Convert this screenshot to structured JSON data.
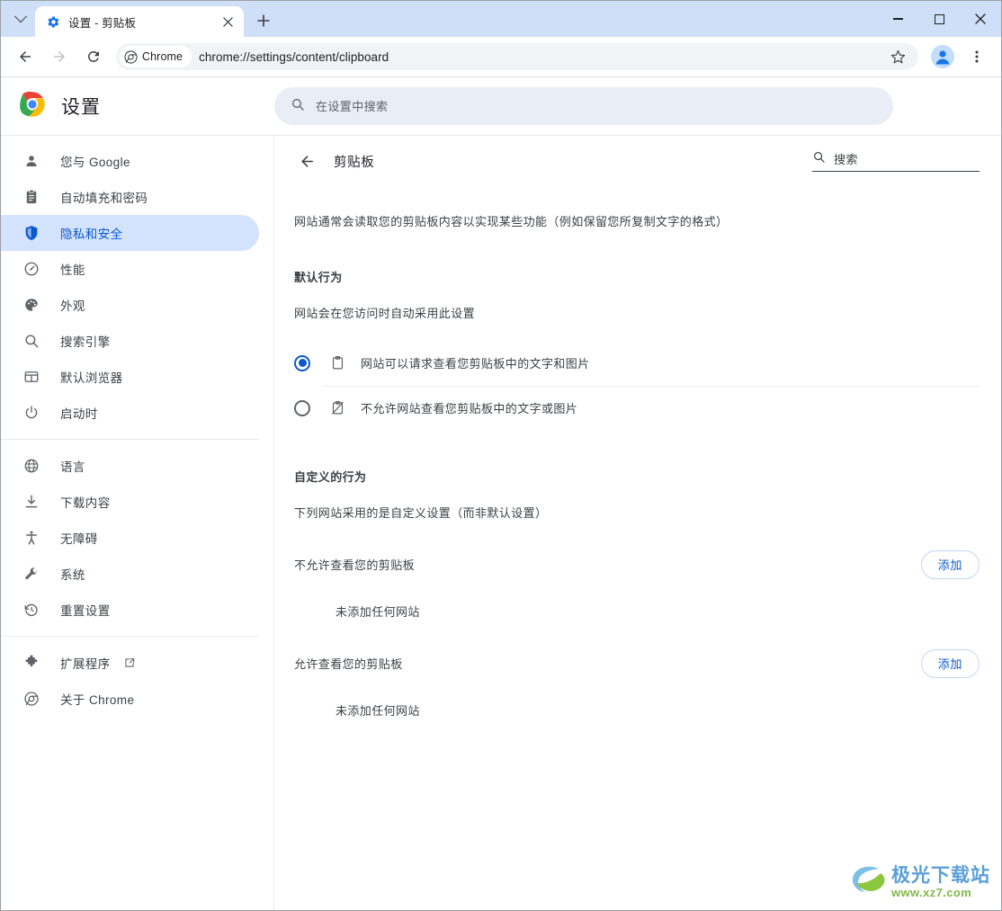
{
  "window": {
    "tab": {
      "title": "设置 - 剪贴板",
      "favicon": "gear-icon",
      "close_label": "×"
    },
    "newtab_label": "+",
    "controls": {
      "minimize": "minimize-icon",
      "maximize": "maximize-icon",
      "close": "close-icon"
    }
  },
  "toolbar": {
    "back": "back-arrow-icon",
    "forward": "forward-arrow-icon",
    "reload": "reload-icon",
    "chrome_badge": "Chrome",
    "url": "chrome://settings/content/clipboard",
    "bookmark": "star-icon",
    "profile": "profile-avatar-icon",
    "menu": "three-dot-menu-icon"
  },
  "settings_header": {
    "brand_title": "设置",
    "search_placeholder": "在设置中搜索",
    "search_value": ""
  },
  "sidebar": {
    "groups": [
      {
        "items": [
          {
            "label": "您与 Google",
            "icon": "person-icon",
            "selected": false
          },
          {
            "label": "自动填充和密码",
            "icon": "clipboard-list-icon",
            "selected": false
          },
          {
            "label": "隐私和安全",
            "icon": "shield-icon",
            "selected": true
          },
          {
            "label": "性能",
            "icon": "speedometer-icon",
            "selected": false
          },
          {
            "label": "外观",
            "icon": "palette-icon",
            "selected": false
          },
          {
            "label": "搜索引擎",
            "icon": "search-icon",
            "selected": false
          },
          {
            "label": "默认浏览器",
            "icon": "browser-window-icon",
            "selected": false
          },
          {
            "label": "启动时",
            "icon": "power-icon",
            "selected": false
          }
        ]
      },
      {
        "items": [
          {
            "label": "语言",
            "icon": "globe-icon",
            "selected": false
          },
          {
            "label": "下载内容",
            "icon": "download-icon",
            "selected": false
          },
          {
            "label": "无障碍",
            "icon": "accessibility-icon",
            "selected": false
          },
          {
            "label": "系统",
            "icon": "wrench-icon",
            "selected": false
          },
          {
            "label": "重置设置",
            "icon": "history-restore-icon",
            "selected": false
          }
        ]
      },
      {
        "items": [
          {
            "label": "扩展程序",
            "icon": "puzzle-icon",
            "selected": false,
            "external": true
          },
          {
            "label": "关于 Chrome",
            "icon": "chrome-logo-icon",
            "selected": false
          }
        ]
      }
    ]
  },
  "main": {
    "back_icon": "back-arrow-icon",
    "title": "剪贴板",
    "search_placeholder": "搜索",
    "search_value": "",
    "description": "网站通常会读取您的剪贴板内容以实现某些功能（例如保留您所复制文字的格式）",
    "default_behavior": {
      "title": "默认行为",
      "subtitle": "网站会在您访问时自动采用此设置",
      "options": [
        {
          "label": "网站可以请求查看您剪贴板中的文字和图片",
          "icon": "clipboard-icon",
          "selected": true
        },
        {
          "label": "不允许网站查看您剪贴板中的文字或图片",
          "icon": "clipboard-blocked-icon",
          "selected": false
        }
      ]
    },
    "custom_behavior": {
      "title": "自定义的行为",
      "subtitle": "下列网站采用的是自定义设置（而非默认设置）",
      "blocks": [
        {
          "title": "不允许查看您的剪贴板",
          "add_label": "添加",
          "empty_text": "未添加任何网站"
        },
        {
          "title": "允许查看您的剪贴板",
          "add_label": "添加",
          "empty_text": "未添加任何网站"
        }
      ]
    }
  },
  "watermark": {
    "main": "极光下载站",
    "sub": "www.xz7.com"
  },
  "colors": {
    "accent_blue": "#0b57d0",
    "selected_pill": "#d3e3fd",
    "tabstrip": "#cfdff8",
    "omnibox": "#f1f3f4",
    "search_bg": "#e9eef6",
    "divider": "#e8eaed"
  }
}
